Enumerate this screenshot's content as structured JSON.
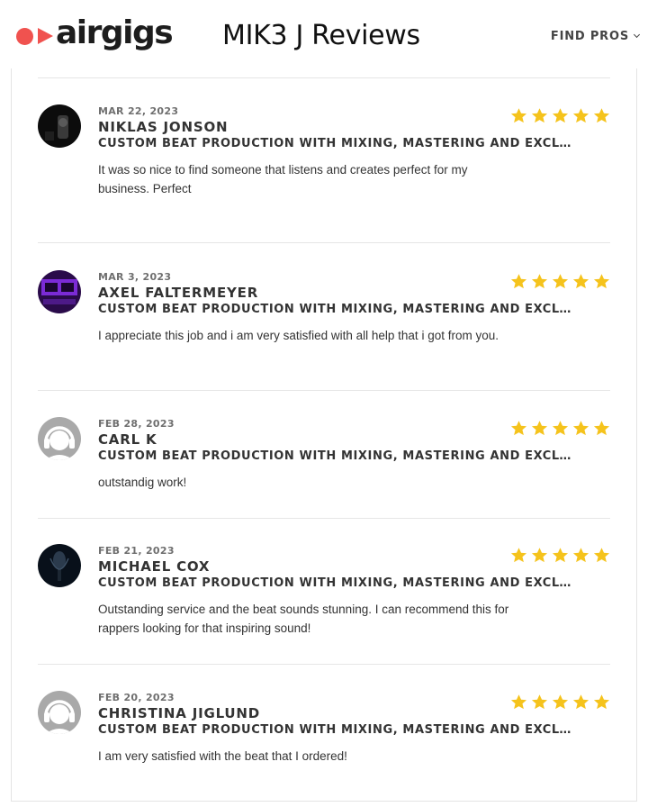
{
  "header": {
    "logo_text": "airgigs",
    "title": "MIK3 J Reviews",
    "find_pros": "FIND PROS"
  },
  "colors": {
    "brand": "#f0524f",
    "star": "#f5c31c"
  },
  "reviews": [
    {
      "date": "MAR 22, 2023",
      "name": "NIKLAS JONSON",
      "service": "CUSTOM BEAT PRODUCTION WITH MIXING, MASTERING AND EXCLUSIVE RIGHTS",
      "text": "It was so nice to find someone that listens and creates perfect for my business. Perfect",
      "rating": 5,
      "avatar": "photo-dark-studio"
    },
    {
      "date": "MAR 3, 2023",
      "name": "AXEL FALTERMEYER",
      "service": "CUSTOM BEAT PRODUCTION WITH MIXING, MASTERING AND EXCLUSIVE RIGHTS",
      "text": "I appreciate this job and i am very satisfied with all help that i got from you.",
      "rating": 5,
      "avatar": "photo-purple-studio"
    },
    {
      "date": "FEB 28, 2023",
      "name": "CARL K",
      "service": "CUSTOM BEAT PRODUCTION WITH MIXING, MASTERING AND EXCLUSIVE RIGHTS",
      "text": "outstandig work!",
      "rating": 5,
      "avatar": "default-headphones"
    },
    {
      "date": "FEB 21, 2023",
      "name": "MICHAEL COX",
      "service": "CUSTOM BEAT PRODUCTION WITH MIXING, MASTERING AND EXCLUSIVE RIGHTS",
      "text": "Outstanding service and the beat sounds stunning. I can recommend this for rappers looking for that inspiring sound!",
      "rating": 5,
      "avatar": "photo-microphone"
    },
    {
      "date": "FEB 20, 2023",
      "name": "CHRISTINA JIGLUND",
      "service": "CUSTOM BEAT PRODUCTION WITH MIXING, MASTERING AND EXCLUSIVE RIGHTS",
      "text": "I am very satisfied with the beat that I ordered!",
      "rating": 5,
      "avatar": "default-headphones"
    }
  ]
}
